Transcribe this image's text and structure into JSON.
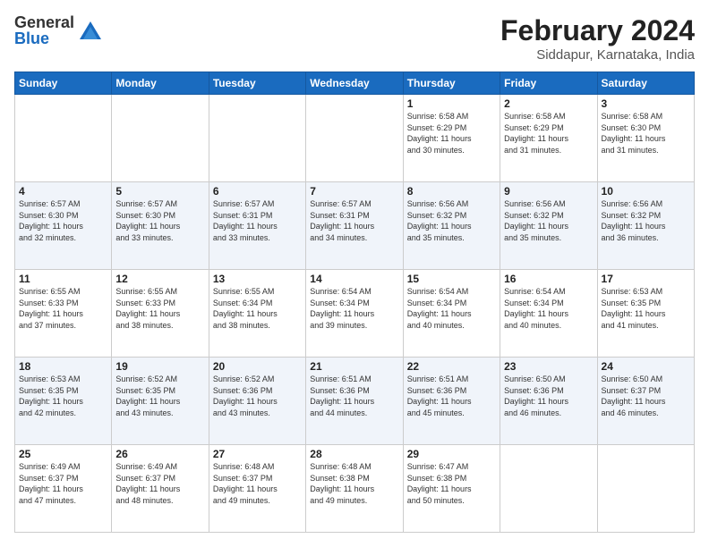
{
  "header": {
    "logo_general": "General",
    "logo_blue": "Blue",
    "month_year": "February 2024",
    "location": "Siddapur, Karnataka, India"
  },
  "days_of_week": [
    "Sunday",
    "Monday",
    "Tuesday",
    "Wednesday",
    "Thursday",
    "Friday",
    "Saturday"
  ],
  "weeks": [
    [
      {
        "day": "",
        "info": ""
      },
      {
        "day": "",
        "info": ""
      },
      {
        "day": "",
        "info": ""
      },
      {
        "day": "",
        "info": ""
      },
      {
        "day": "1",
        "info": "Sunrise: 6:58 AM\nSunset: 6:29 PM\nDaylight: 11 hours\nand 30 minutes."
      },
      {
        "day": "2",
        "info": "Sunrise: 6:58 AM\nSunset: 6:29 PM\nDaylight: 11 hours\nand 31 minutes."
      },
      {
        "day": "3",
        "info": "Sunrise: 6:58 AM\nSunset: 6:30 PM\nDaylight: 11 hours\nand 31 minutes."
      }
    ],
    [
      {
        "day": "4",
        "info": "Sunrise: 6:57 AM\nSunset: 6:30 PM\nDaylight: 11 hours\nand 32 minutes."
      },
      {
        "day": "5",
        "info": "Sunrise: 6:57 AM\nSunset: 6:30 PM\nDaylight: 11 hours\nand 33 minutes."
      },
      {
        "day": "6",
        "info": "Sunrise: 6:57 AM\nSunset: 6:31 PM\nDaylight: 11 hours\nand 33 minutes."
      },
      {
        "day": "7",
        "info": "Sunrise: 6:57 AM\nSunset: 6:31 PM\nDaylight: 11 hours\nand 34 minutes."
      },
      {
        "day": "8",
        "info": "Sunrise: 6:56 AM\nSunset: 6:32 PM\nDaylight: 11 hours\nand 35 minutes."
      },
      {
        "day": "9",
        "info": "Sunrise: 6:56 AM\nSunset: 6:32 PM\nDaylight: 11 hours\nand 35 minutes."
      },
      {
        "day": "10",
        "info": "Sunrise: 6:56 AM\nSunset: 6:32 PM\nDaylight: 11 hours\nand 36 minutes."
      }
    ],
    [
      {
        "day": "11",
        "info": "Sunrise: 6:55 AM\nSunset: 6:33 PM\nDaylight: 11 hours\nand 37 minutes."
      },
      {
        "day": "12",
        "info": "Sunrise: 6:55 AM\nSunset: 6:33 PM\nDaylight: 11 hours\nand 38 minutes."
      },
      {
        "day": "13",
        "info": "Sunrise: 6:55 AM\nSunset: 6:34 PM\nDaylight: 11 hours\nand 38 minutes."
      },
      {
        "day": "14",
        "info": "Sunrise: 6:54 AM\nSunset: 6:34 PM\nDaylight: 11 hours\nand 39 minutes."
      },
      {
        "day": "15",
        "info": "Sunrise: 6:54 AM\nSunset: 6:34 PM\nDaylight: 11 hours\nand 40 minutes."
      },
      {
        "day": "16",
        "info": "Sunrise: 6:54 AM\nSunset: 6:34 PM\nDaylight: 11 hours\nand 40 minutes."
      },
      {
        "day": "17",
        "info": "Sunrise: 6:53 AM\nSunset: 6:35 PM\nDaylight: 11 hours\nand 41 minutes."
      }
    ],
    [
      {
        "day": "18",
        "info": "Sunrise: 6:53 AM\nSunset: 6:35 PM\nDaylight: 11 hours\nand 42 minutes."
      },
      {
        "day": "19",
        "info": "Sunrise: 6:52 AM\nSunset: 6:35 PM\nDaylight: 11 hours\nand 43 minutes."
      },
      {
        "day": "20",
        "info": "Sunrise: 6:52 AM\nSunset: 6:36 PM\nDaylight: 11 hours\nand 43 minutes."
      },
      {
        "day": "21",
        "info": "Sunrise: 6:51 AM\nSunset: 6:36 PM\nDaylight: 11 hours\nand 44 minutes."
      },
      {
        "day": "22",
        "info": "Sunrise: 6:51 AM\nSunset: 6:36 PM\nDaylight: 11 hours\nand 45 minutes."
      },
      {
        "day": "23",
        "info": "Sunrise: 6:50 AM\nSunset: 6:36 PM\nDaylight: 11 hours\nand 46 minutes."
      },
      {
        "day": "24",
        "info": "Sunrise: 6:50 AM\nSunset: 6:37 PM\nDaylight: 11 hours\nand 46 minutes."
      }
    ],
    [
      {
        "day": "25",
        "info": "Sunrise: 6:49 AM\nSunset: 6:37 PM\nDaylight: 11 hours\nand 47 minutes."
      },
      {
        "day": "26",
        "info": "Sunrise: 6:49 AM\nSunset: 6:37 PM\nDaylight: 11 hours\nand 48 minutes."
      },
      {
        "day": "27",
        "info": "Sunrise: 6:48 AM\nSunset: 6:37 PM\nDaylight: 11 hours\nand 49 minutes."
      },
      {
        "day": "28",
        "info": "Sunrise: 6:48 AM\nSunset: 6:38 PM\nDaylight: 11 hours\nand 49 minutes."
      },
      {
        "day": "29",
        "info": "Sunrise: 6:47 AM\nSunset: 6:38 PM\nDaylight: 11 hours\nand 50 minutes."
      },
      {
        "day": "",
        "info": ""
      },
      {
        "day": "",
        "info": ""
      }
    ]
  ]
}
